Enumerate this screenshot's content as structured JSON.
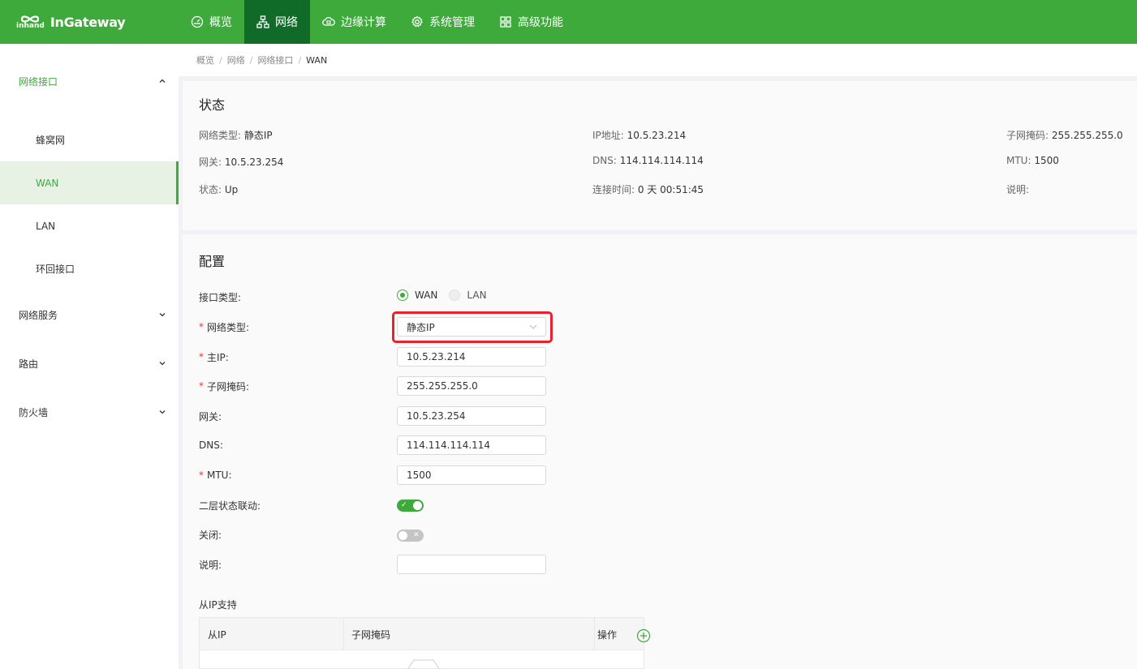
{
  "brand": {
    "logo_small": "inhand",
    "name": "InGateway"
  },
  "colors": {
    "primary": "#3eaa3c",
    "nav_active": "#106a28",
    "highlight": "#e8212c"
  },
  "topnav": [
    {
      "label": "概览",
      "icon": "dashboard-icon"
    },
    {
      "label": "网络",
      "icon": "network-icon",
      "active": true
    },
    {
      "label": "边缘计算",
      "icon": "edge-computing-icon"
    },
    {
      "label": "系统管理",
      "icon": "settings-gear-icon"
    },
    {
      "label": "高级功能",
      "icon": "grid-apps-icon"
    }
  ],
  "sidebar": {
    "groups": [
      {
        "label": "网络接口",
        "expanded": true,
        "items": [
          "蜂窝网",
          "WAN",
          "LAN",
          "环回接口"
        ],
        "active_item": "WAN"
      },
      {
        "label": "网络服务",
        "expanded": false
      },
      {
        "label": "路由",
        "expanded": false
      },
      {
        "label": "防火墙",
        "expanded": false
      }
    ]
  },
  "breadcrumb": [
    "概览",
    "网络",
    "网络接口",
    "WAN"
  ],
  "status": {
    "title": "状态",
    "rows": [
      {
        "label": "网络类型",
        "value": "静态IP"
      },
      {
        "label": "IP地址",
        "value": "10.5.23.214"
      },
      {
        "label": "子网掩码",
        "value": "255.255.255.0"
      },
      {
        "label": "网关",
        "value": "10.5.23.254"
      },
      {
        "label": "DNS",
        "value": "114.114.114.114"
      },
      {
        "label": "MTU",
        "value": "1500"
      },
      {
        "label": "状态",
        "value": "Up"
      },
      {
        "label": "连接时间",
        "value": "0 天 00:51:45"
      },
      {
        "label": "说明",
        "value": ""
      }
    ]
  },
  "config": {
    "title": "配置",
    "interface_type": {
      "label": "接口类型:",
      "options": [
        "WAN",
        "LAN"
      ],
      "selected": "WAN"
    },
    "network_type": {
      "label": "网络类型:",
      "value": "静态IP",
      "required": true
    },
    "primary_ip": {
      "label": "主IP:",
      "value": "10.5.23.214",
      "required": true
    },
    "netmask": {
      "label": "子网掩码:",
      "value": "255.255.255.0",
      "required": true
    },
    "gateway": {
      "label": "网关:",
      "value": "10.5.23.254"
    },
    "dns": {
      "label": "DNS:",
      "value": "114.114.114.114"
    },
    "mtu": {
      "label": "MTU:",
      "value": "1500",
      "required": true
    },
    "l2_link": {
      "label": "二层状态联动:",
      "on": true
    },
    "shutdown": {
      "label": "关闭:",
      "on": false
    },
    "description": {
      "label": "说明:",
      "value": ""
    },
    "secondary_ip": {
      "title": "从IP支持",
      "columns": [
        "从IP",
        "子网掩码",
        "操作"
      ]
    }
  },
  "required_mark": "*",
  "toggle_marks": {
    "on": "✓",
    "off": "✕"
  }
}
